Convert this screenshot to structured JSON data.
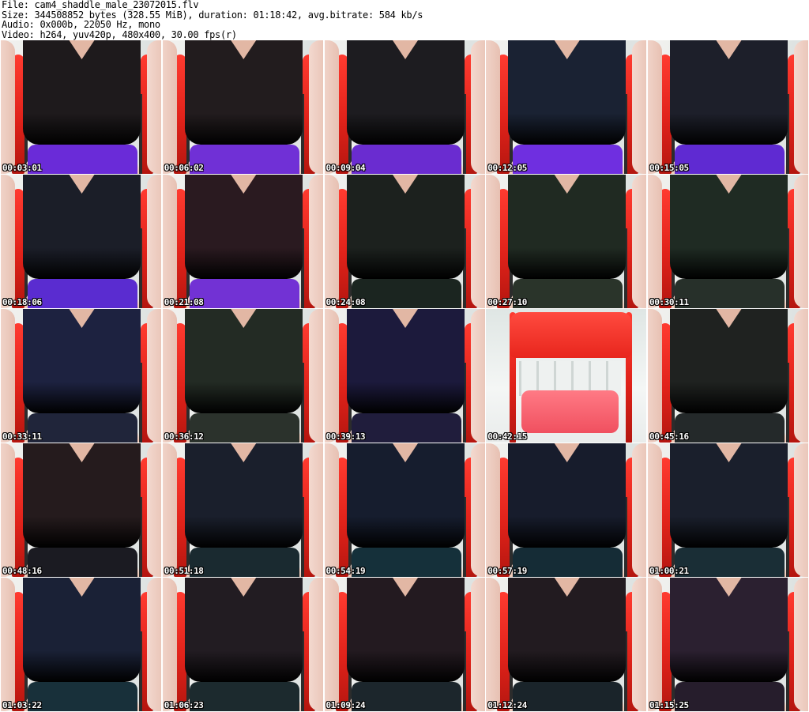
{
  "header": {
    "file_line": "File: cam4_shaddle_male_23072015.flv",
    "size_line": "Size: 344508852 bytes (328.55 MiB), duration: 01:18:42, avg.bitrate: 584 kb/s",
    "audio_line": "Audio: 0x000b, 22050 Hz, mono",
    "video_line": "Video: h264, yuv420p, 480x400, 30.00 fps(r)"
  },
  "thumbnails": [
    {
      "timestamp": "00:03:01",
      "shirt": "#1e1a1c",
      "shorts": "#6a2bd8"
    },
    {
      "timestamp": "00:06:02",
      "shirt": "#221c1e",
      "shorts": "#7030d6"
    },
    {
      "timestamp": "00:09:04",
      "shirt": "#1d1c20",
      "shorts": "#6a2cd0"
    },
    {
      "timestamp": "00:12:05",
      "shirt": "#1a2233",
      "shorts": "#6f2fe0"
    },
    {
      "timestamp": "00:15:05",
      "shirt": "#1d1f2a",
      "shorts": "#5f2ad2"
    },
    {
      "timestamp": "00:18:06",
      "shirt": "#1b1e28",
      "shorts": "#5a2cd0"
    },
    {
      "timestamp": "00:21:08",
      "shirt": "#2a1a20",
      "shorts": "#7232d4"
    },
    {
      "timestamp": "00:24:08",
      "shirt": "#1c211e",
      "shorts": "#1b2520"
    },
    {
      "timestamp": "00:27:10",
      "shirt": "#202a22",
      "shorts": "#2a342a"
    },
    {
      "timestamp": "00:30:11",
      "shirt": "#1f2b23",
      "shorts": "#27302a"
    },
    {
      "timestamp": "00:33:11",
      "shirt": "#1d2240",
      "shorts": "#20253a"
    },
    {
      "timestamp": "00:36:12",
      "shirt": "#232b24",
      "shorts": "#2b322c"
    },
    {
      "timestamp": "00:39:13",
      "shirt": "#1c1a3c",
      "shorts": "#201d3c"
    },
    {
      "timestamp": "00:42:15",
      "shirt": "#e9eceb",
      "shorts": "#f06a78"
    },
    {
      "timestamp": "00:45:16",
      "shirt": "#1f2220",
      "shorts": "#24292a"
    },
    {
      "timestamp": "00:48:16",
      "shirt": "#251b1d",
      "shorts": "#1b1b22"
    },
    {
      "timestamp": "00:51:18",
      "shirt": "#1a1f2c",
      "shorts": "#1a2a30"
    },
    {
      "timestamp": "00:54:19",
      "shirt": "#161d2e",
      "shorts": "#15303a"
    },
    {
      "timestamp": "00:57:19",
      "shirt": "#171c2c",
      "shorts": "#152c36"
    },
    {
      "timestamp": "01:00:21",
      "shirt": "#1a1f2c",
      "shorts": "#1a2e36"
    },
    {
      "timestamp": "01:03:22",
      "shirt": "#1a2136",
      "shorts": "#18303a"
    },
    {
      "timestamp": "01:06:23",
      "shirt": "#221c22",
      "shorts": "#1c2a2e"
    },
    {
      "timestamp": "01:09:24",
      "shirt": "#231a20",
      "shorts": "#1c262c"
    },
    {
      "timestamp": "01:12:24",
      "shirt": "#221b20",
      "shorts": "#1a242a"
    },
    {
      "timestamp": "01:15:25",
      "shirt": "#2b2030",
      "shorts": "#261d2c"
    }
  ]
}
